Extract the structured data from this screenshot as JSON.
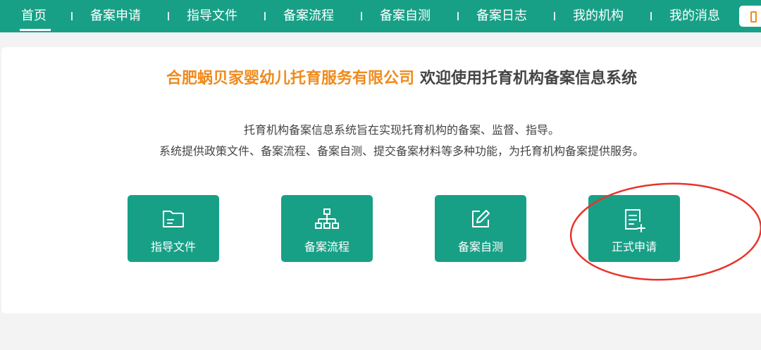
{
  "nav": {
    "items": [
      "首页",
      "备案申请",
      "指导文件",
      "备案流程",
      "备案自测",
      "备案日志",
      "我的机构",
      "我的消息"
    ]
  },
  "header": {
    "org_name": "合肥蜗贝家婴幼儿托育服务有限公司",
    "welcome": "欢迎使用托育机构备案信息系统"
  },
  "description": {
    "line1": "托育机构备案信息系统旨在实现托育机构的备案、监督、指导。",
    "line2": "系统提供政策文件、备案流程、备案自测、提交备案材料等多种功能，为托育机构备案提供服务。"
  },
  "tiles": [
    {
      "label": "指导文件",
      "icon": "folder-icon"
    },
    {
      "label": "备案流程",
      "icon": "sitemap-icon"
    },
    {
      "label": "备案自测",
      "icon": "edit-icon"
    },
    {
      "label": "正式申请",
      "icon": "document-add-icon"
    }
  ],
  "colors": {
    "primary": "#18a087",
    "accent": "#f08a1c",
    "annotation": "#e8342b"
  }
}
